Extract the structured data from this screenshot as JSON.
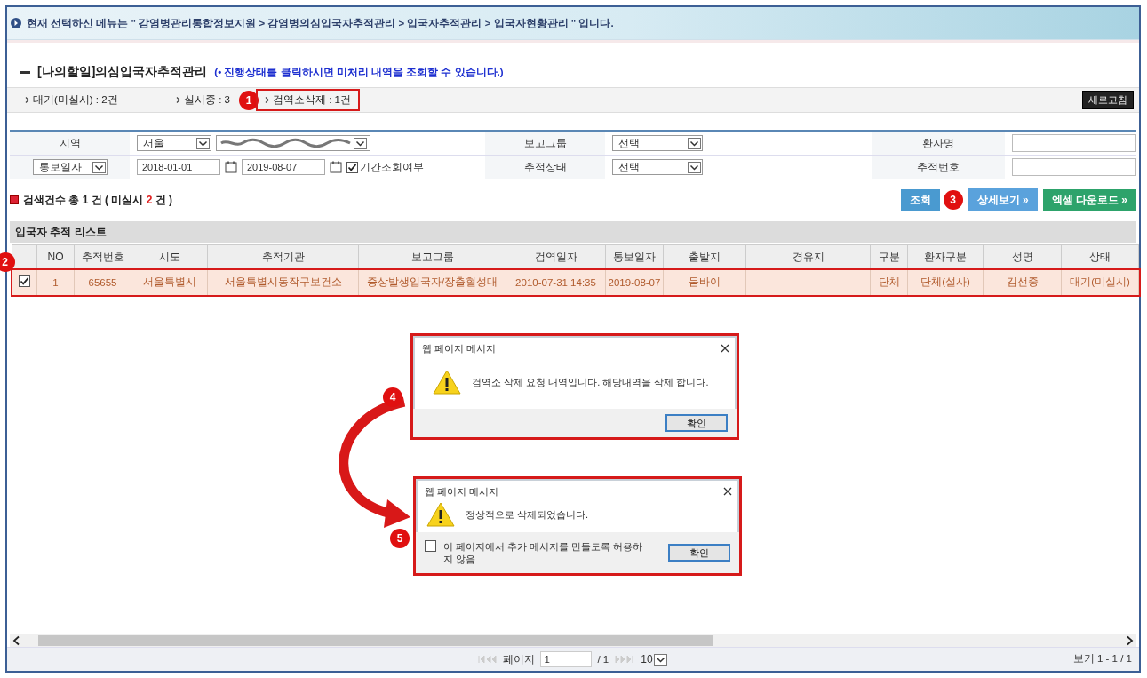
{
  "breadcrumb": "현재 선택하신 메뉴는 \" 감염병관리통합정보지원 > 감염병의심입국자추적관리 > 입국자추적관리 > 입국자현황관리 \" 입니다.",
  "page_title": "[나의할일]의심입국자추적관리",
  "hint": "(• 진행상태를 클릭하시면 미처리 내역을 조회할 수 있습니다.)",
  "status_tabs": [
    {
      "label": "대기(미실시) : 2건",
      "highlighted": false
    },
    {
      "label": "실시중 : 3",
      "highlighted": false
    },
    {
      "label": "검역소삭제 : 1건",
      "highlighted": true
    }
  ],
  "refresh_button": "새로고침",
  "search_form": {
    "region_label": "지역",
    "city_select": "서울",
    "report_group_label": "보고그룹",
    "report_group_select": "선택",
    "patient_name_label": "환자명",
    "date_type_select": "통보일자",
    "date_from": "2018-01-01",
    "date_to": "2019-08-07",
    "period_checkbox": {
      "label": "기간조회여부",
      "checked": true
    },
    "tracking_status_label": "추적상태",
    "tracking_status_select": "선택",
    "tracking_number_label": "추적번호"
  },
  "result_summary": {
    "prefix": "검색건수 총 1 건 ( 미실시 ",
    "count": "2",
    "suffix": " 건 )"
  },
  "buttons": [
    {
      "label": "조회",
      "kind": "search",
      "highlighted": false
    },
    {
      "label": "상세보기 »",
      "kind": "detail",
      "highlighted": true
    },
    {
      "label": "엑셀 다운로드 »",
      "kind": "excel",
      "highlighted": false
    }
  ],
  "list": {
    "title": "입국자 추적 리스트",
    "columns": [
      "NO",
      "추적번호",
      "시도",
      "추적기관",
      "보고그룹",
      "검역일자",
      "통보일자",
      "출발지",
      "경유지",
      "구분",
      "환자구분",
      "성명",
      "상태"
    ],
    "rows": [
      {
        "selected": true,
        "cells": [
          "1",
          "65655",
          "서울특별시",
          "서울특별시동작구보건소",
          "증상발생입국자/장출혈성대",
          "2010-07-31 14:35",
          "2019-08-07",
          "뭄바이",
          "",
          "단체",
          "단체(설사)",
          "김선중",
          "대기(미실시)"
        ]
      }
    ]
  },
  "dialogs": [
    {
      "title": "웹 페이지 메시지",
      "message": "검역소 삭제 요청 내역입니다. 해당내역을 삭제 합니다.",
      "ok": "확인"
    },
    {
      "title": "웹 페이지 메시지",
      "message": "정상적으로 삭제되었습니다.",
      "ok": "확인",
      "suppress": {
        "label": "이 페이지에서 추가 메시지를 만들도록 허용하지 않음",
        "checked": false
      }
    }
  ],
  "pager": {
    "page_label": "페이지",
    "page": "1",
    "total": "/ 1",
    "page_size": "10",
    "summary": "보기 1 - 1 / 1"
  },
  "callouts": [
    "1",
    "2",
    "3",
    "4",
    "5"
  ]
}
